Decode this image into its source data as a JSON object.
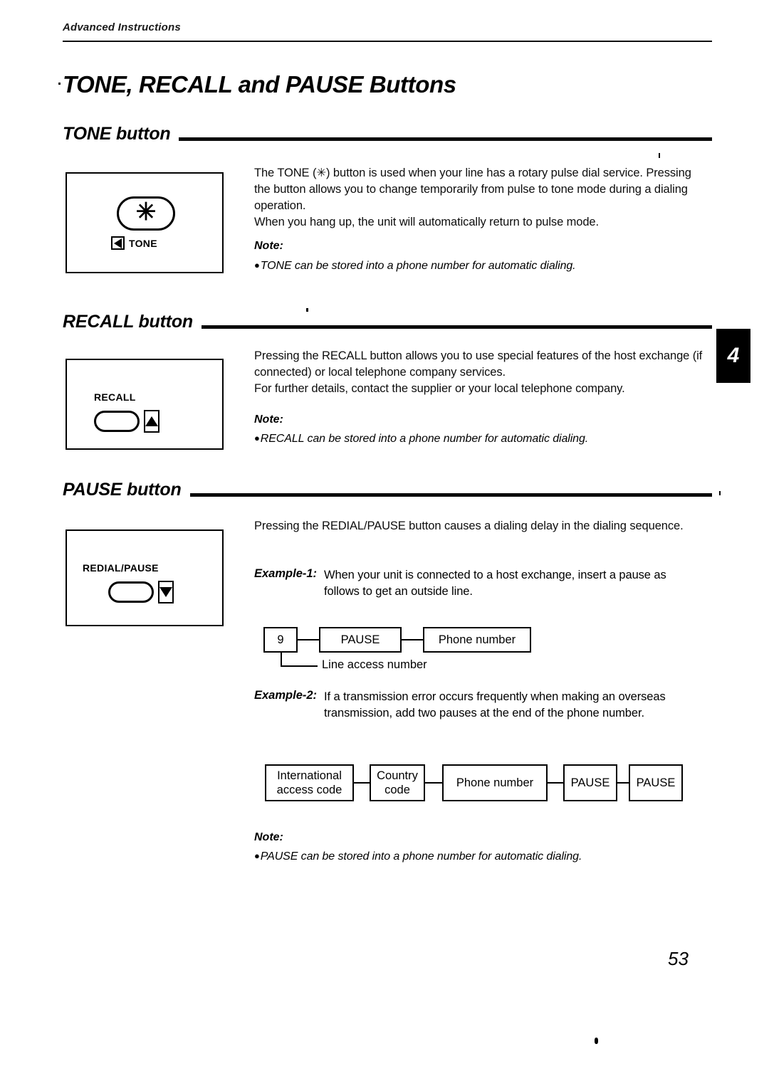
{
  "document": {
    "running_head": "Advanced Instructions",
    "chapter_title": "TONE, RECALL and PAUSE Buttons",
    "chapter_tab": "4",
    "page_number": "53"
  },
  "sections": [
    {
      "heading": "TONE button",
      "illustration": {
        "key_glyph": "✳",
        "indicator_icon": "triangle-left-icon",
        "caption": "TONE"
      },
      "paragraphs": [
        "The TONE (✳) button is used when your line has a rotary pulse dial service. Pressing the button allows you to change temporarily from pulse to tone mode during a dialing operation.",
        "When you hang up, the unit will automatically return to pulse mode."
      ],
      "note_label": "Note:",
      "notes": [
        "TONE can be stored into a phone number for automatic dialing."
      ]
    },
    {
      "heading": "RECALL button",
      "illustration": {
        "key_label": "RECALL",
        "indicator_icon": "triangle-up-icon"
      },
      "paragraphs": [
        "Pressing the RECALL button allows you to use special features of the host exchange (if connected) or local telephone company services.",
        "For further details, contact the supplier or your local telephone company."
      ],
      "note_label": "Note:",
      "notes": [
        "RECALL can be stored into a phone number for automatic dialing."
      ]
    },
    {
      "heading": "PAUSE button",
      "illustration": {
        "key_label": "REDIAL/PAUSE",
        "indicator_icon": "triangle-down-icon"
      },
      "paragraphs": [
        "Pressing the REDIAL/PAUSE button causes a dialing delay in the dialing sequence."
      ],
      "examples": [
        {
          "tag": "Example-1:",
          "text": "When your unit is connected to a host exchange, insert a pause as follows to get an outside line.",
          "diagram": {
            "boxes": [
              "9",
              "PAUSE",
              "Phone number"
            ],
            "callout": "Line access number"
          }
        },
        {
          "tag": "Example-2:",
          "text": "If a transmission error occurs frequently when making an overseas transmission, add two pauses at the end of the phone number.",
          "diagram": {
            "boxes": [
              "International access code",
              "Country code",
              "Phone number",
              "PAUSE",
              "PAUSE"
            ]
          }
        }
      ],
      "note_label": "Note:",
      "notes": [
        "PAUSE can be stored into a phone number for automatic dialing."
      ]
    }
  ]
}
